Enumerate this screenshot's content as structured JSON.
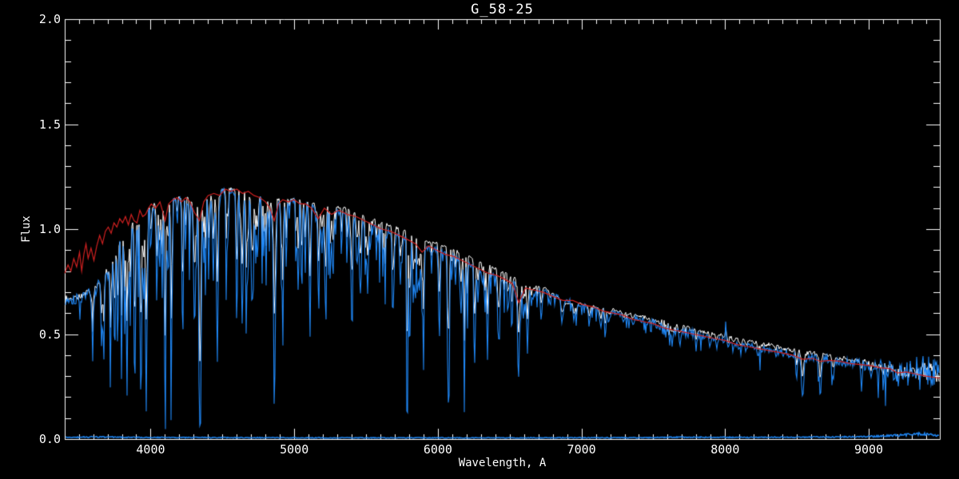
{
  "title": "G_58-25",
  "axes": {
    "xlabel": "Wavelength, A",
    "ylabel": "Flux",
    "xlim": [
      3402,
      9495
    ],
    "ylim": [
      0,
      2
    ],
    "x_tick_values": [
      4000,
      5000,
      6000,
      7000,
      8000,
      9000
    ],
    "x_tick_labels": [
      "4000",
      "5000",
      "6000",
      "7000",
      "8000",
      "9000"
    ],
    "x_minor_step": 100,
    "y_tick_values": [
      0.0,
      0.5,
      1.0,
      1.5,
      2.0
    ],
    "y_tick_labels": [
      "0.0",
      "0.5",
      "1.0",
      "1.5",
      "2.0"
    ],
    "y_minor_step": 0.1,
    "grid": "off",
    "frame": "full-box-with-inward-ticks"
  },
  "colors": {
    "background": "#000000",
    "frame": "#ffffff",
    "text": "#ffffff",
    "white_spectrum": "#ffffff",
    "blue_spectrum": "#1f87f5",
    "red_model": "#cf2020"
  },
  "chart_data": {
    "type": "line",
    "title": "G_58-25",
    "xlabel": "Wavelength, A",
    "ylabel": "Flux",
    "xlim": [
      3402,
      9495
    ],
    "ylim": [
      0,
      2
    ],
    "legend": "none",
    "series": [
      {
        "name": "white-spectrum",
        "color": "#ffffff"
      },
      {
        "name": "blue-spectrum",
        "color": "#1f87f5"
      },
      {
        "name": "red-model",
        "color": "#cf2020"
      },
      {
        "name": "error-spectrum",
        "color": "#1f87f5"
      }
    ],
    "blue_spectrum": {
      "continuum_points": [
        [
          3402,
          0.66
        ],
        [
          3450,
          0.67
        ],
        [
          3500,
          0.67
        ],
        [
          3550,
          0.69
        ],
        [
          3600,
          0.71
        ],
        [
          3650,
          0.75
        ],
        [
          3700,
          0.8
        ],
        [
          3750,
          0.88
        ],
        [
          3800,
          0.95
        ],
        [
          3850,
          1.0
        ],
        [
          3900,
          1.04
        ],
        [
          3950,
          1.07
        ],
        [
          4000,
          1.1
        ],
        [
          4100,
          1.13
        ],
        [
          4200,
          1.14
        ],
        [
          4300,
          1.13
        ],
        [
          4400,
          1.15
        ],
        [
          4500,
          1.18
        ],
        [
          4600,
          1.18
        ],
        [
          4700,
          1.17
        ],
        [
          4800,
          1.13
        ],
        [
          4900,
          1.13
        ],
        [
          5000,
          1.13
        ],
        [
          5100,
          1.11
        ],
        [
          5200,
          1.09
        ],
        [
          5300,
          1.08
        ],
        [
          5400,
          1.06
        ],
        [
          5500,
          1.03
        ],
        [
          5600,
          1.0
        ],
        [
          5700,
          0.98
        ],
        [
          5800,
          0.95
        ],
        [
          5900,
          0.91
        ],
        [
          6000,
          0.9
        ],
        [
          6100,
          0.87
        ],
        [
          6200,
          0.84
        ],
        [
          6300,
          0.81
        ],
        [
          6400,
          0.78
        ],
        [
          6500,
          0.75
        ],
        [
          6600,
          0.72
        ],
        [
          6700,
          0.71
        ],
        [
          6800,
          0.69
        ],
        [
          6900,
          0.66
        ],
        [
          7000,
          0.64
        ],
        [
          7100,
          0.62
        ],
        [
          7200,
          0.61
        ],
        [
          7300,
          0.59
        ],
        [
          7400,
          0.57
        ],
        [
          7500,
          0.55
        ],
        [
          7600,
          0.53
        ],
        [
          7700,
          0.51
        ],
        [
          7800,
          0.5
        ],
        [
          7900,
          0.48
        ],
        [
          8000,
          0.47
        ],
        [
          8100,
          0.45
        ],
        [
          8200,
          0.44
        ],
        [
          8300,
          0.43
        ],
        [
          8400,
          0.41
        ],
        [
          8500,
          0.4
        ],
        [
          8600,
          0.39
        ],
        [
          8700,
          0.38
        ],
        [
          8800,
          0.37
        ],
        [
          8900,
          0.36
        ],
        [
          9000,
          0.35
        ],
        [
          9100,
          0.34
        ],
        [
          9200,
          0.32
        ],
        [
          9300,
          0.32
        ],
        [
          9400,
          0.33
        ],
        [
          9495,
          0.3
        ]
      ],
      "absorption_lines": [
        [
          3727,
          0.3,
          4
        ],
        [
          3750,
          0.45,
          4
        ],
        [
          3771,
          0.52,
          4
        ],
        [
          3798,
          0.62,
          4
        ],
        [
          3820,
          0.45,
          3
        ],
        [
          3835,
          0.8,
          4
        ],
        [
          3860,
          0.5,
          3
        ],
        [
          3889,
          0.84,
          4
        ],
        [
          3933,
          0.86,
          5
        ],
        [
          3969,
          0.88,
          5
        ],
        [
          4045,
          0.3,
          3
        ],
        [
          4101,
          0.77,
          5
        ],
        [
          4144,
          0.35,
          3
        ],
        [
          4226,
          0.45,
          3
        ],
        [
          4271,
          0.35,
          3
        ],
        [
          4305,
          0.45,
          7
        ],
        [
          4340,
          0.66,
          5
        ],
        [
          4383,
          0.45,
          3
        ],
        [
          4405,
          0.35,
          3
        ],
        [
          4458,
          0.25,
          3
        ],
        [
          4528,
          0.3,
          3
        ],
        [
          4668,
          0.28,
          3
        ],
        [
          4750,
          0.2,
          3
        ],
        [
          4861,
          0.72,
          5
        ],
        [
          4921,
          0.25,
          3
        ],
        [
          5050,
          0.2,
          3
        ],
        [
          5170,
          0.45,
          5
        ],
        [
          5270,
          0.28,
          5
        ],
        [
          5329,
          0.22,
          3
        ],
        [
          5404,
          0.18,
          3
        ],
        [
          5530,
          0.15,
          3
        ],
        [
          5890,
          0.2,
          6
        ],
        [
          6122,
          0.15,
          4
        ],
        [
          6163,
          0.12,
          3
        ],
        [
          6280,
          0.12,
          5
        ],
        [
          6310,
          0.1,
          4
        ],
        [
          6495,
          0.12,
          4
        ],
        [
          6563,
          0.6,
          5
        ],
        [
          6717,
          0.1,
          4
        ],
        [
          6870,
          0.12,
          8
        ],
        [
          7190,
          0.08,
          10
        ],
        [
          7620,
          0.1,
          20
        ],
        [
          8230,
          0.12,
          6
        ],
        [
          8498,
          0.3,
          5
        ],
        [
          8542,
          0.45,
          6
        ],
        [
          8662,
          0.48,
          6
        ],
        [
          8750,
          0.25,
          5
        ],
        [
          8950,
          0.15,
          5
        ],
        [
          9015,
          0.12,
          5
        ],
        [
          9100,
          0.2,
          4
        ],
        [
          9200,
          0.15,
          8
        ]
      ],
      "emission_spikes": [
        [
          8006,
          0.13,
          2.2
        ],
        [
          5243,
          0.06,
          2.0
        ]
      ],
      "noise_amplitude_points": [
        [
          3402,
          0.03
        ],
        [
          3700,
          0.025
        ],
        [
          3900,
          0.022
        ],
        [
          4100,
          0.02
        ],
        [
          4500,
          0.018
        ],
        [
          5000,
          0.015
        ],
        [
          5500,
          0.014
        ],
        [
          6000,
          0.013
        ],
        [
          6500,
          0.012
        ],
        [
          7000,
          0.012
        ],
        [
          7400,
          0.013
        ],
        [
          7550,
          0.03
        ],
        [
          7615,
          0.055
        ],
        [
          7700,
          0.03
        ],
        [
          7800,
          0.016
        ],
        [
          8200,
          0.016
        ],
        [
          8500,
          0.018
        ],
        [
          8800,
          0.022
        ],
        [
          9000,
          0.03
        ],
        [
          9150,
          0.045
        ],
        [
          9250,
          0.065
        ],
        [
          9350,
          0.075
        ],
        [
          9450,
          0.068
        ],
        [
          9495,
          0.06
        ]
      ],
      "noise_spike_probability": 0.05,
      "noise_seed": 101
    },
    "white_spectrum": {
      "offset_points": [
        [
          3402,
          0.005
        ],
        [
          4200,
          0.008
        ],
        [
          4800,
          0.01
        ],
        [
          5100,
          0.018
        ],
        [
          5400,
          0.03
        ],
        [
          5800,
          0.032
        ],
        [
          6200,
          0.035
        ],
        [
          6500,
          0.03
        ],
        [
          6750,
          0.02
        ],
        [
          6880,
          -0.015
        ],
        [
          7000,
          0.005
        ],
        [
          7250,
          0.012
        ],
        [
          7500,
          0.018
        ],
        [
          7800,
          0.02
        ],
        [
          8200,
          0.022
        ],
        [
          8600,
          0.02
        ],
        [
          9000,
          0.012
        ],
        [
          9250,
          0.008
        ],
        [
          9495,
          0.0
        ]
      ],
      "line_depth_factor": 0.55,
      "noise_factor": 0.55,
      "noise_seed": 202
    },
    "red_model": {
      "points": [
        [
          3402,
          0.79
        ],
        [
          3425,
          0.83
        ],
        [
          3445,
          0.8
        ],
        [
          3465,
          0.86
        ],
        [
          3485,
          0.82
        ],
        [
          3505,
          0.89
        ],
        [
          3520,
          0.8
        ],
        [
          3535,
          0.88
        ],
        [
          3550,
          0.93
        ],
        [
          3565,
          0.86
        ],
        [
          3585,
          0.91
        ],
        [
          3605,
          0.85
        ],
        [
          3625,
          0.92
        ],
        [
          3645,
          0.97
        ],
        [
          3665,
          0.93
        ],
        [
          3685,
          0.99
        ],
        [
          3705,
          1.01
        ],
        [
          3725,
          0.98
        ],
        [
          3745,
          1.03
        ],
        [
          3765,
          1.01
        ],
        [
          3785,
          1.05
        ],
        [
          3805,
          1.03
        ],
        [
          3825,
          1.06
        ],
        [
          3845,
          1.02
        ],
        [
          3865,
          1.07
        ],
        [
          3885,
          1.04
        ],
        [
          3905,
          1.03
        ],
        [
          3925,
          1.09
        ],
        [
          3945,
          1.06
        ],
        [
          3965,
          1.07
        ],
        [
          3985,
          1.1
        ],
        [
          4005,
          1.12
        ],
        [
          4035,
          1.1
        ],
        [
          4065,
          1.13
        ],
        [
          4090,
          1.07
        ],
        [
          4101,
          1.04
        ],
        [
          4125,
          1.12
        ],
        [
          4155,
          1.14
        ],
        [
          4185,
          1.15
        ],
        [
          4215,
          1.13
        ],
        [
          4245,
          1.15
        ],
        [
          4275,
          1.13
        ],
        [
          4305,
          1.08
        ],
        [
          4340,
          1.04
        ],
        [
          4370,
          1.13
        ],
        [
          4400,
          1.16
        ],
        [
          4440,
          1.17
        ],
        [
          4480,
          1.16
        ],
        [
          4520,
          1.19
        ],
        [
          4560,
          1.18
        ],
        [
          4600,
          1.19
        ],
        [
          4640,
          1.17
        ],
        [
          4680,
          1.18
        ],
        [
          4720,
          1.16
        ],
        [
          4760,
          1.15
        ],
        [
          4800,
          1.13
        ],
        [
          4830,
          1.1
        ],
        [
          4861,
          1.04
        ],
        [
          4890,
          1.12
        ],
        [
          4920,
          1.14
        ],
        [
          4960,
          1.13
        ],
        [
          5000,
          1.14
        ],
        [
          5040,
          1.12
        ],
        [
          5080,
          1.12
        ],
        [
          5120,
          1.1
        ],
        [
          5167,
          1.05
        ],
        [
          5210,
          1.1
        ],
        [
          5260,
          1.07
        ],
        [
          5310,
          1.09
        ],
        [
          5370,
          1.07
        ],
        [
          5430,
          1.06
        ],
        [
          5490,
          1.04
        ],
        [
          5550,
          1.02
        ],
        [
          5610,
          1.0
        ],
        [
          5670,
          0.99
        ],
        [
          5730,
          0.97
        ],
        [
          5790,
          0.95
        ],
        [
          5845,
          0.93
        ],
        [
          5890,
          0.89
        ],
        [
          5935,
          0.92
        ],
        [
          5990,
          0.9
        ],
        [
          6050,
          0.88
        ],
        [
          6110,
          0.87
        ],
        [
          6170,
          0.85
        ],
        [
          6230,
          0.83
        ],
        [
          6290,
          0.81
        ],
        [
          6350,
          0.79
        ],
        [
          6410,
          0.78
        ],
        [
          6470,
          0.76
        ],
        [
          6520,
          0.74
        ],
        [
          6563,
          0.65
        ],
        [
          6610,
          0.72
        ],
        [
          6670,
          0.71
        ],
        [
          6730,
          0.7
        ],
        [
          6800,
          0.68
        ],
        [
          6870,
          0.66
        ],
        [
          6940,
          0.66
        ],
        [
          7010,
          0.64
        ],
        [
          7080,
          0.63
        ],
        [
          7150,
          0.61
        ],
        [
          7220,
          0.6
        ],
        [
          7290,
          0.59
        ],
        [
          7360,
          0.57
        ],
        [
          7430,
          0.56
        ],
        [
          7500,
          0.55
        ],
        [
          7570,
          0.53
        ],
        [
          7640,
          0.52
        ],
        [
          7710,
          0.51
        ],
        [
          7780,
          0.5
        ],
        [
          7850,
          0.49
        ],
        [
          7920,
          0.48
        ],
        [
          8000,
          0.47
        ],
        [
          8080,
          0.45
        ],
        [
          8160,
          0.44
        ],
        [
          8240,
          0.43
        ],
        [
          8320,
          0.42
        ],
        [
          8400,
          0.41
        ],
        [
          8470,
          0.4
        ],
        [
          8542,
          0.38
        ],
        [
          8610,
          0.385
        ],
        [
          8662,
          0.37
        ],
        [
          8730,
          0.375
        ],
        [
          8800,
          0.37
        ],
        [
          8870,
          0.36
        ],
        [
          8940,
          0.355
        ],
        [
          9010,
          0.35
        ],
        [
          9080,
          0.34
        ],
        [
          9150,
          0.335
        ],
        [
          9200,
          0.315
        ],
        [
          9260,
          0.32
        ],
        [
          9330,
          0.31
        ],
        [
          9400,
          0.3
        ],
        [
          9495,
          0.29
        ]
      ]
    },
    "error_spectrum": {
      "points": [
        [
          3402,
          0.008
        ],
        [
          3600,
          0.01
        ],
        [
          3900,
          0.008
        ],
        [
          4500,
          0.007
        ],
        [
          5500,
          0.006
        ],
        [
          6500,
          0.006
        ],
        [
          7500,
          0.007
        ],
        [
          7615,
          0.009
        ],
        [
          8200,
          0.008
        ],
        [
          8800,
          0.01
        ],
        [
          9100,
          0.014
        ],
        [
          9250,
          0.02
        ],
        [
          9340,
          0.024
        ],
        [
          9420,
          0.022
        ],
        [
          9495,
          0.016
        ]
      ],
      "noise_factor": 0.3,
      "noise_seed": 303
    },
    "metal_line_forest": {
      "seed": 911,
      "segments": [
        {
          "count": 210,
          "wl_range": [
            3560,
            6650
          ],
          "depth_range": [
            0.04,
            0.38
          ],
          "sigma_range": [
            1.8,
            5.0
          ]
        },
        {
          "count": 60,
          "wl_range": [
            6650,
            9430
          ],
          "depth_range": [
            0.03,
            0.12
          ],
          "sigma_range": [
            2.0,
            6.0
          ]
        }
      ]
    }
  }
}
